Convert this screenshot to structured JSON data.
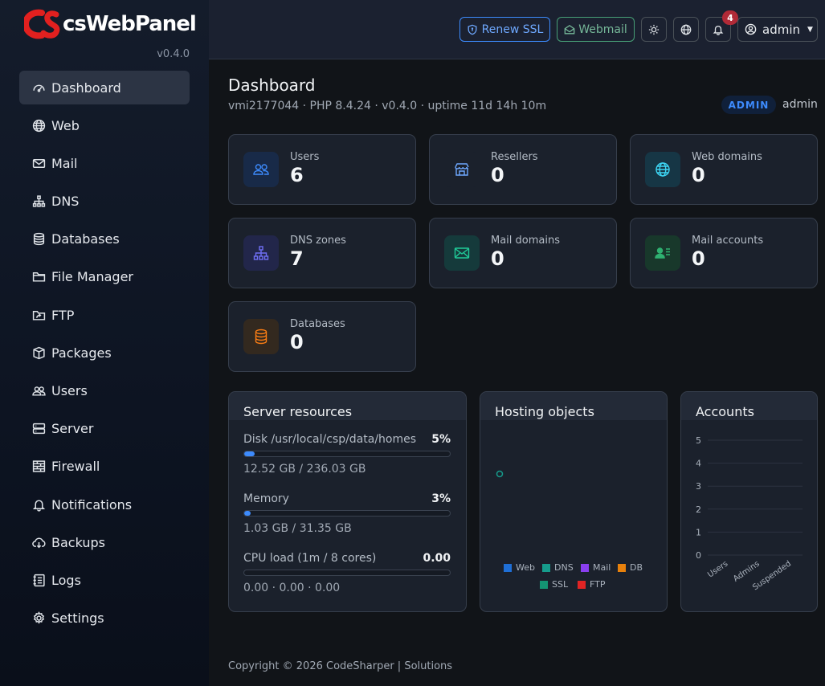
{
  "brand": {
    "name": "csWebPanel",
    "version": "v0.4.0"
  },
  "sidebar": {
    "items": [
      {
        "label": "Dashboard",
        "icon": "speedometer-icon"
      },
      {
        "label": "Web",
        "icon": "globe-icon"
      },
      {
        "label": "Mail",
        "icon": "envelope-icon"
      },
      {
        "label": "DNS",
        "icon": "diagram-icon"
      },
      {
        "label": "Databases",
        "icon": "database-icon"
      },
      {
        "label": "File Manager",
        "icon": "folder-icon"
      },
      {
        "label": "FTP",
        "icon": "folder-symlink-icon"
      },
      {
        "label": "Packages",
        "icon": "box-icon"
      },
      {
        "label": "Users",
        "icon": "people-icon"
      },
      {
        "label": "Server",
        "icon": "hdd-stack-icon"
      },
      {
        "label": "Firewall",
        "icon": "bricks-icon"
      },
      {
        "label": "Notifications",
        "icon": "bell-icon"
      },
      {
        "label": "Backups",
        "icon": "cloud-download-icon"
      },
      {
        "label": "Logs",
        "icon": "journal-icon"
      },
      {
        "label": "Settings",
        "icon": "gear-icon"
      }
    ]
  },
  "topbar": {
    "renew_ssl": "Renew SSL",
    "webmail": "Webmail",
    "notification_count": "4",
    "user": "admin"
  },
  "header": {
    "title": "Dashboard",
    "subtitle": "vmi2177044 · PHP 8.4.24 · v0.4.0 · uptime 11d 14h 10m",
    "role_badge": "ADMIN",
    "role_user": "admin"
  },
  "stats": [
    {
      "label": "Users",
      "value": "6",
      "icon": "people-icon",
      "color": "#3d8bfd"
    },
    {
      "label": "Resellers",
      "value": "0",
      "icon": "shop-icon",
      "color": "#6ea8fe"
    },
    {
      "label": "Web domains",
      "value": "0",
      "icon": "globe-icon",
      "color": "#3dd5f3"
    },
    {
      "label": "DNS zones",
      "value": "7",
      "icon": "diagram-icon",
      "color": "#6f6ff5"
    },
    {
      "label": "Mail domains",
      "value": "0",
      "icon": "envelope-icon",
      "color": "#20c997"
    },
    {
      "label": "Mail accounts",
      "value": "0",
      "icon": "person-lines-icon",
      "color": "#2fb171"
    },
    {
      "label": "Databases",
      "value": "0",
      "icon": "database-icon",
      "color": "#fd7e14"
    }
  ],
  "resources": {
    "title": "Server resources",
    "rows": [
      {
        "label": "Disk /usr/local/csp/data/homes",
        "percent": "5%",
        "fill": 5,
        "detail": "12.52 GB / 236.03 GB"
      },
      {
        "label": "Memory",
        "percent": "3%",
        "fill": 3,
        "detail": "1.03 GB / 31.35 GB"
      },
      {
        "label": "CPU load (1m / 8 cores)",
        "percent": "0.00",
        "fill": 0,
        "detail": "0.00 · 0.00 · 0.00"
      }
    ]
  },
  "hosting": {
    "title": "Hosting objects",
    "legend": [
      {
        "name": "Web",
        "color": "#1f6fd6"
      },
      {
        "name": "DNS",
        "color": "#169c8c"
      },
      {
        "name": "Mail",
        "color": "#8a3ff0"
      },
      {
        "name": "DB",
        "color": "#e8810c"
      },
      {
        "name": "SSL",
        "color": "#149473"
      },
      {
        "name": "FTP",
        "color": "#e02424"
      }
    ]
  },
  "accounts": {
    "title": "Accounts",
    "chart_data": {
      "type": "bar",
      "categories": [
        "Users",
        "Admins",
        "Suspended"
      ],
      "ylim": [
        0,
        5
      ],
      "yticks": [
        "0",
        "1",
        "2",
        "3",
        "4",
        "5"
      ],
      "grid": true
    }
  },
  "footer": "Copyright © 2026 CodeSharper | Solutions"
}
